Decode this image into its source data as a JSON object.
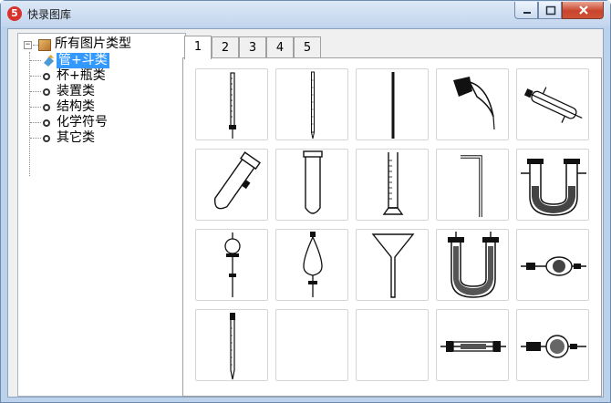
{
  "window": {
    "title": "快录图库",
    "app_icon_glyph": "5"
  },
  "tree": {
    "root_label": "所有图片类型",
    "expander": "−",
    "items": [
      {
        "label": "管+斗类",
        "selected": true
      },
      {
        "label": "杯+瓶类",
        "selected": false
      },
      {
        "label": "装置类",
        "selected": false
      },
      {
        "label": "结构类",
        "selected": false
      },
      {
        "label": "化学符号",
        "selected": false
      },
      {
        "label": "其它类",
        "selected": false
      }
    ]
  },
  "tabs": [
    "1",
    "2",
    "3",
    "4",
    "5"
  ],
  "active_tab": "1",
  "grid": [
    [
      "burette-icon",
      "pipette-icon",
      "glass-rod-icon",
      "curved-tube-icon",
      "condenser-icon"
    ],
    [
      "tilted-test-tube-icon",
      "test-tube-icon",
      "graduated-cylinder-icon",
      "bent-tube-icon",
      "u-tube-drying-icon"
    ],
    [
      "bulb-dropping-funnel-icon",
      "separatory-funnel-icon",
      "funnel-icon",
      "u-tube-filled-icon",
      "drying-tube-bulb-icon"
    ],
    [
      "long-pipette-icon",
      "empty-slot",
      "empty-slot",
      "drying-tube-horizontal-icon",
      "drying-tube-ball-icon"
    ]
  ]
}
